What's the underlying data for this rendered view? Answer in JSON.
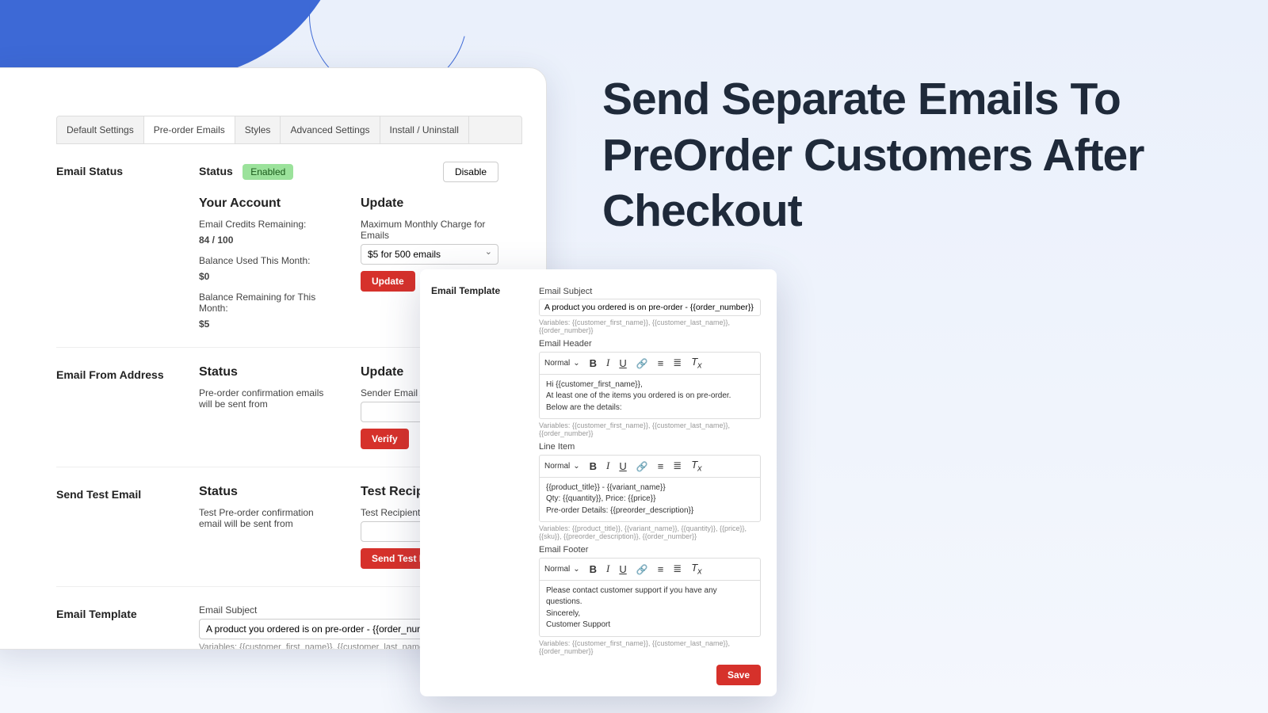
{
  "headline": "Send Separate Emails To PreOrder Customers After Checkout",
  "tabs": [
    {
      "label": "Default Settings"
    },
    {
      "label": "Pre-order Emails"
    },
    {
      "label": "Styles"
    },
    {
      "label": "Advanced Settings"
    },
    {
      "label": "Install / Uninstall"
    }
  ],
  "status": {
    "section": "Email Status",
    "label": "Status",
    "badge": "Enabled",
    "disable": "Disable"
  },
  "account": {
    "heading": "Your Account",
    "credits_label": "Email Credits Remaining:",
    "credits_value": "84 / 100",
    "used_label": "Balance Used This Month:",
    "used_value": "$0",
    "remain_label": "Balance Remaining for This Month:",
    "remain_value": "$5"
  },
  "update": {
    "heading": "Update",
    "field_label": "Maximum Monthly Charge for Emails",
    "select_value": "$5 for 500 emails",
    "button": "Update"
  },
  "from": {
    "section": "Email From Address",
    "status_heading": "Status",
    "status_text": "Pre-order confirmation emails will be sent from",
    "update_heading": "Update",
    "field_label": "Sender Email Address",
    "button": "Verify"
  },
  "test": {
    "section": "Send Test Email",
    "status_heading": "Status",
    "status_text": "Test Pre-order confirmation email will be sent from",
    "recipient_heading": "Test Recipient",
    "field_label": "Test Recipient Email Address",
    "button": "Send Test Email"
  },
  "template_section": {
    "section": "Email Template",
    "subject_label": "Email Subject",
    "subject_value": "A product you ordered is on pre-order - {{order_number}}",
    "vars": "Variables:  {{customer_first_name}}, {{customer_last_name}}, {{order_number}}"
  },
  "card": {
    "title": "Email Template",
    "subject_label": "Email Subject",
    "subject_value": "A product you ordered is on pre-order - {{order_number}}",
    "subject_vars": "Variables:  {{customer_first_name}}, {{customer_last_name}}, {{order_number}}",
    "header_label": "Email Header",
    "format": "Normal",
    "header_body1": "Hi {{customer_first_name}},",
    "header_body2": "At least one of the items you ordered is on pre-order. Below are the details:",
    "header_vars": "Variables:  {{customer_first_name}}, {{customer_last_name}}, {{order_number}}",
    "line_label": "Line Item",
    "line_body1": "{{product_title}} - {{variant_name}}",
    "line_body2": "Qty: {{quantity}}, Price: {{price}}",
    "line_body3": "Pre-order Details: {{preorder_description}}",
    "line_vars": "Variables:  {{product_title}}, {{variant_name}}, {{quantity}}, {{price}}, {{sku}}, {{preorder_description}}, {{order_number}}",
    "footer_label": "Email Footer",
    "footer_body1": "Please contact customer support if you have any questions.",
    "footer_body2": "Sincerely,",
    "footer_body3": "Customer Support",
    "footer_vars": "Variables:  {{customer_first_name}}, {{customer_last_name}}, {{order_number}}",
    "save": "Save"
  }
}
